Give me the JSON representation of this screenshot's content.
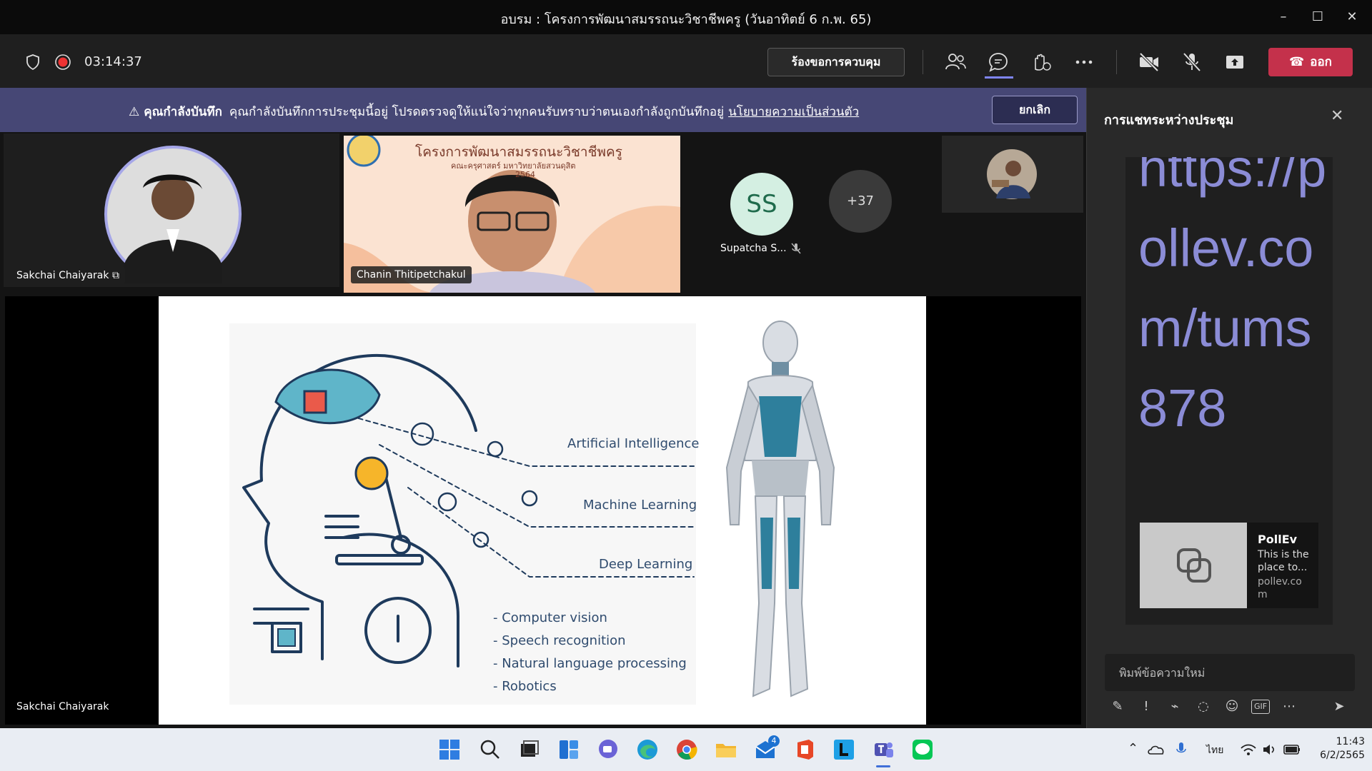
{
  "window": {
    "title": "อบรม : โครงการพัฒนาสมรรถนะวิชาชีพครู (วันอาทิตย์ 6 ก.พ. 65)",
    "minimize": "–",
    "maximize": "☐",
    "close": "✕"
  },
  "toolbar": {
    "timer": "03:14:37",
    "request_control_label": "ร้องขอการควบคุม",
    "leave_label": "ออก"
  },
  "banner": {
    "heading": "คุณกำลังบันทึก",
    "message": "คุณกำลังบันทึกการประชุมนี้อยู่ โปรดตรวจดูให้แน่ใจว่าทุกคนรับทราบว่าตนเองกำลังถูกบันทึกอยู่",
    "policy_link": "นโยบายความเป็นส่วนตัว",
    "dismiss_label": "ยกเลิก"
  },
  "participants": {
    "tile1_name": "Sakchai Chaiyarak",
    "tile2_name": "Chanin Thitipetchakul",
    "tile3_initials": "SS",
    "tile3_name": "Supatcha S...",
    "more_count": "+37",
    "share_presenter": "Sakchai Chaiyarak"
  },
  "shared_video_overlay": {
    "line1": "โครงการพัฒนาสมรรถนะวิชาชีพครู",
    "line2": "คณะครุศาสตร์ มหาวิทยาลัยสวนดุสิต",
    "line3": "2564"
  },
  "slide": {
    "labels": [
      "Artificial Intelligence",
      "Machine Learning",
      "Deep Learning"
    ],
    "applications": [
      "- Computer vision",
      "- Speech recognition",
      "- Natural language processing",
      "- Robotics"
    ]
  },
  "chat": {
    "title": "การแชทระหว่างประชุม",
    "message_link": "https://pollev.com/tums878",
    "preview": {
      "title": "PollEv",
      "description": "This is the place to...",
      "domain": "pollev.com"
    },
    "compose_placeholder": "พิมพ์ข้อความใหม่"
  },
  "taskbar": {
    "language": "ไทย",
    "time": "11:43",
    "date": "6/2/2565",
    "mail_badge": "4"
  }
}
